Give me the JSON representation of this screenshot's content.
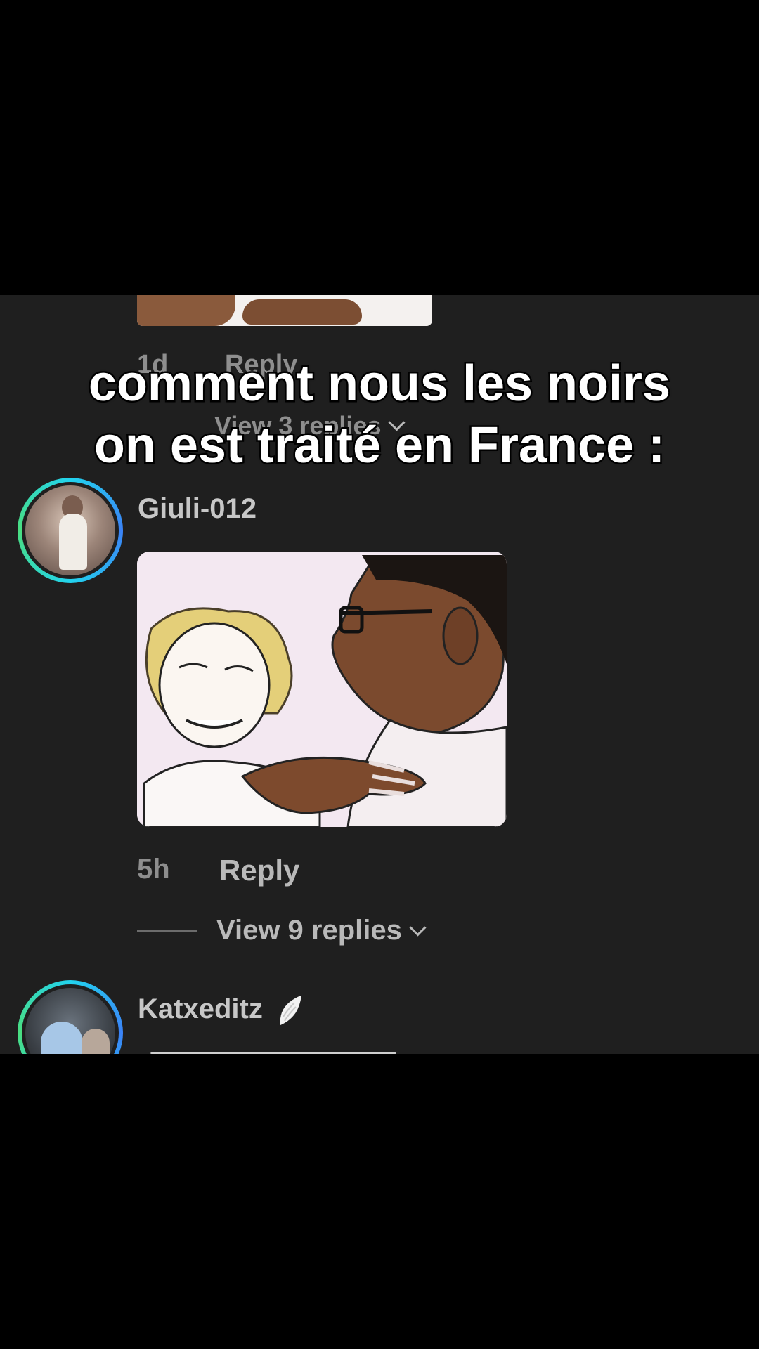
{
  "prev_comment": {
    "time": "1d",
    "reply_label": "Reply",
    "view_replies": "View 3 replies"
  },
  "comments": [
    {
      "username": "Giuli-012",
      "time": "5h",
      "reply_label": "Reply",
      "view_replies": "View 9 replies"
    },
    {
      "username": "Katxeditz",
      "badge_icon": "wing-icon"
    }
  ],
  "overlay_caption": {
    "line1": "comment nous les noirs",
    "line2": "on est traité en France :"
  },
  "colors": {
    "background": "#1f1f1f",
    "avatar_ring": "#22d3ee",
    "meta_text": "#8e8e8e"
  }
}
